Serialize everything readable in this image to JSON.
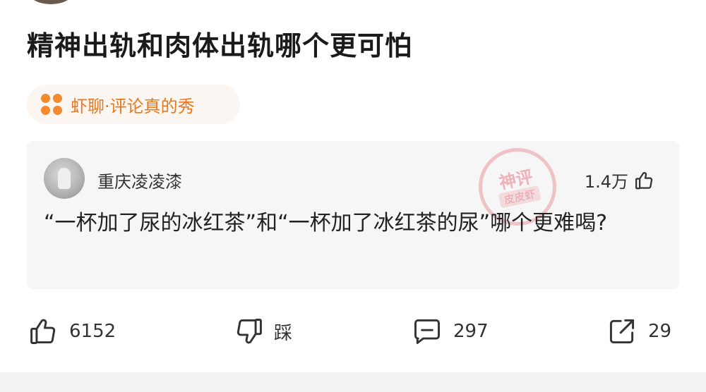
{
  "post": {
    "title": "精神出轨和肉体出轨哪个更可怕",
    "tag_label": "虾聊·评论真的秀"
  },
  "comment": {
    "username": "重庆凌凌漆",
    "likes": "1.4万",
    "text": "“一杯加了尿的冰红茶”和“一杯加了冰红茶的尿”哪个更难喝?",
    "watermark_top": "神评",
    "watermark_bottom": "皮皮虾"
  },
  "actions": {
    "like_count": "6152",
    "dislike_label": "踩",
    "comment_count": "297",
    "share_count": "29"
  },
  "colors": {
    "accent_orange": "#e8781e",
    "watermark_pink": "#e26070"
  },
  "icons": {
    "tag": "four-dots-icon",
    "comment_like": "thumbs-up-icon",
    "like": "thumbs-up-icon",
    "dislike": "thumbs-down-icon",
    "comment": "comment-bubble-icon",
    "share": "share-icon"
  }
}
